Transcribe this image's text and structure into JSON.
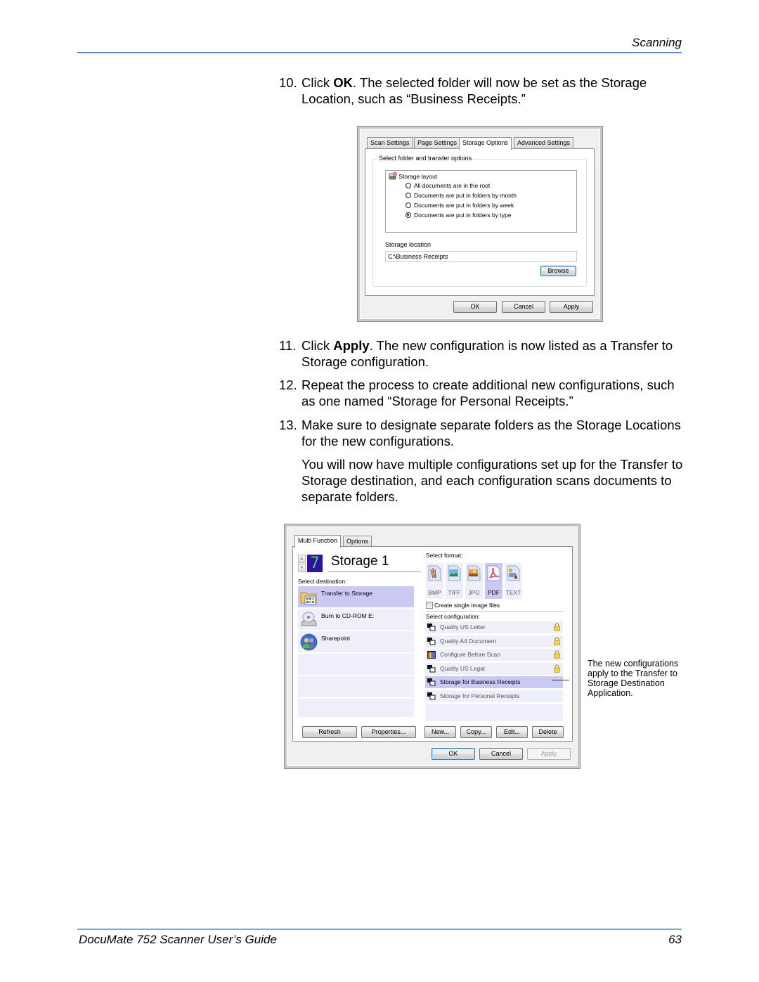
{
  "header": {
    "section": "Scanning"
  },
  "footer": {
    "title": "DocuMate 752 Scanner User’s Guide",
    "page": "63"
  },
  "steps": [
    {
      "num": "10.",
      "pre": "Click ",
      "bold": "OK",
      "post": ". The selected folder will now be set as the Storage Location, such as “Business Receipts.”"
    },
    {
      "num": "11.",
      "pre": "Click ",
      "bold": "Apply",
      "post": ". The new configuration is now listed as a Transfer to Storage configuration."
    },
    {
      "num": "12.",
      "pre": "",
      "bold": "",
      "post": "Repeat the process to create additional new configurations, such as one named “Storage for Personal Receipts.”"
    },
    {
      "num": "13.",
      "pre": "",
      "bold": "",
      "post": "Make sure to designate separate folders as the Storage Locations for the new configurations."
    }
  ],
  "note": "You will now have multiple configurations set up for the Transfer to Storage destination, and each configuration scans documents to separate folders.",
  "dialog1": {
    "tabs": [
      "Scan Settings",
      "Page Settings",
      "Storage Options",
      "Advanced Settings"
    ],
    "active_tab": "Storage Options",
    "group_label": "Select folder and transfer options",
    "layout_label": "Storage layout",
    "layout_options": [
      {
        "label": "All documents are in the root",
        "checked": false
      },
      {
        "label": "Documents are put in folders by month",
        "checked": false
      },
      {
        "label": "Documents are put in folders by week",
        "checked": false
      },
      {
        "label": "Documents are put in folders by type",
        "checked": true
      }
    ],
    "location_label": "Storage location",
    "location_value": "C:\\Business Receipts",
    "browse_label": "Browse",
    "ok_label": "OK",
    "cancel_label": "Cancel",
    "apply_label": "Apply"
  },
  "dialog2": {
    "tabs": [
      "Multi Function",
      "Options"
    ],
    "active_tab": "Multi Function",
    "counter_value": "7",
    "config_title": "Storage 1",
    "destination_label": "Select destination:",
    "destinations": [
      {
        "label": "Transfer to Storage",
        "icon": "folder-grid-icon",
        "selected": true
      },
      {
        "label": "Burn to CD-ROM  E:",
        "icon": "cd-drive-icon",
        "selected": false
      },
      {
        "label": "Sharepoint",
        "icon": "users-icon",
        "selected": false
      }
    ],
    "format_label": "Select format:",
    "formats": [
      {
        "label": "BMP",
        "icon": "bmp-file-icon",
        "selected": false
      },
      {
        "label": "TIFF",
        "icon": "tiff-file-icon",
        "selected": false
      },
      {
        "label": "JPG",
        "icon": "jpg-file-icon",
        "selected": false
      },
      {
        "label": "PDF",
        "icon": "pdf-file-icon",
        "selected": true
      },
      {
        "label": "TEXT",
        "icon": "text-file-icon",
        "selected": false
      }
    ],
    "single_image_label": "Create single image files",
    "single_image_checked": false,
    "configuration_label": "Select configuration:",
    "configurations": [
      {
        "label": "Quality US Letter",
        "locked": true,
        "selected": false,
        "icon": "scanner-config-icon"
      },
      {
        "label": "Quality A4 Document",
        "locked": true,
        "selected": false,
        "icon": "scanner-config-icon"
      },
      {
        "label": "Configure Before Scan",
        "locked": true,
        "selected": false,
        "icon": "color-bars-icon"
      },
      {
        "label": "Quality US Legal",
        "locked": true,
        "selected": false,
        "icon": "scanner-config-icon"
      },
      {
        "label": "Storage for Business Receipts",
        "locked": false,
        "selected": true,
        "icon": "scanner-config-icon"
      },
      {
        "label": "Storage for Personal Receipts",
        "locked": false,
        "selected": false,
        "icon": "scanner-config-icon"
      }
    ],
    "buttons": {
      "refresh": "Refresh",
      "properties": "Properties...",
      "new": "New...",
      "copy": "Copy...",
      "edit": "Edit...",
      "delete": "Delete",
      "ok": "OK",
      "cancel": "Cancel",
      "apply": "Apply"
    }
  },
  "callout": "The new configurations apply to the Transfer to Storage Destination Application."
}
